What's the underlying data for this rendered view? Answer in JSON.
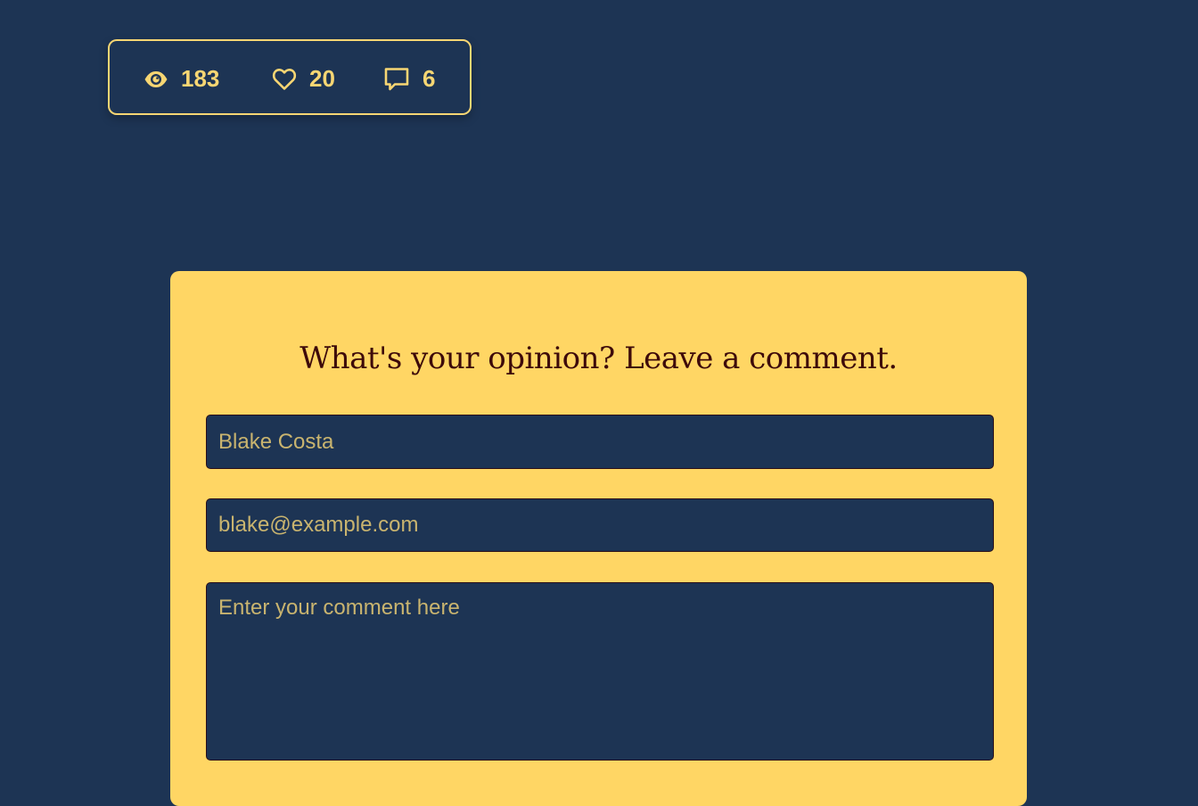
{
  "stats": {
    "views": "183",
    "likes": "20",
    "comments": "6",
    "icons": [
      "eye-icon",
      "heart-icon",
      "speech-bubble-icon"
    ],
    "accent_color": "#f7d673"
  },
  "comment_form": {
    "title": "What's your opinion? Leave a comment.",
    "name_placeholder": "Blake Costa",
    "email_placeholder": "blake@example.com",
    "comment_placeholder": "Enter your comment here",
    "card_color": "#ffd664",
    "field_color": "#1d3454"
  },
  "page": {
    "background_color": "#1d3454"
  }
}
